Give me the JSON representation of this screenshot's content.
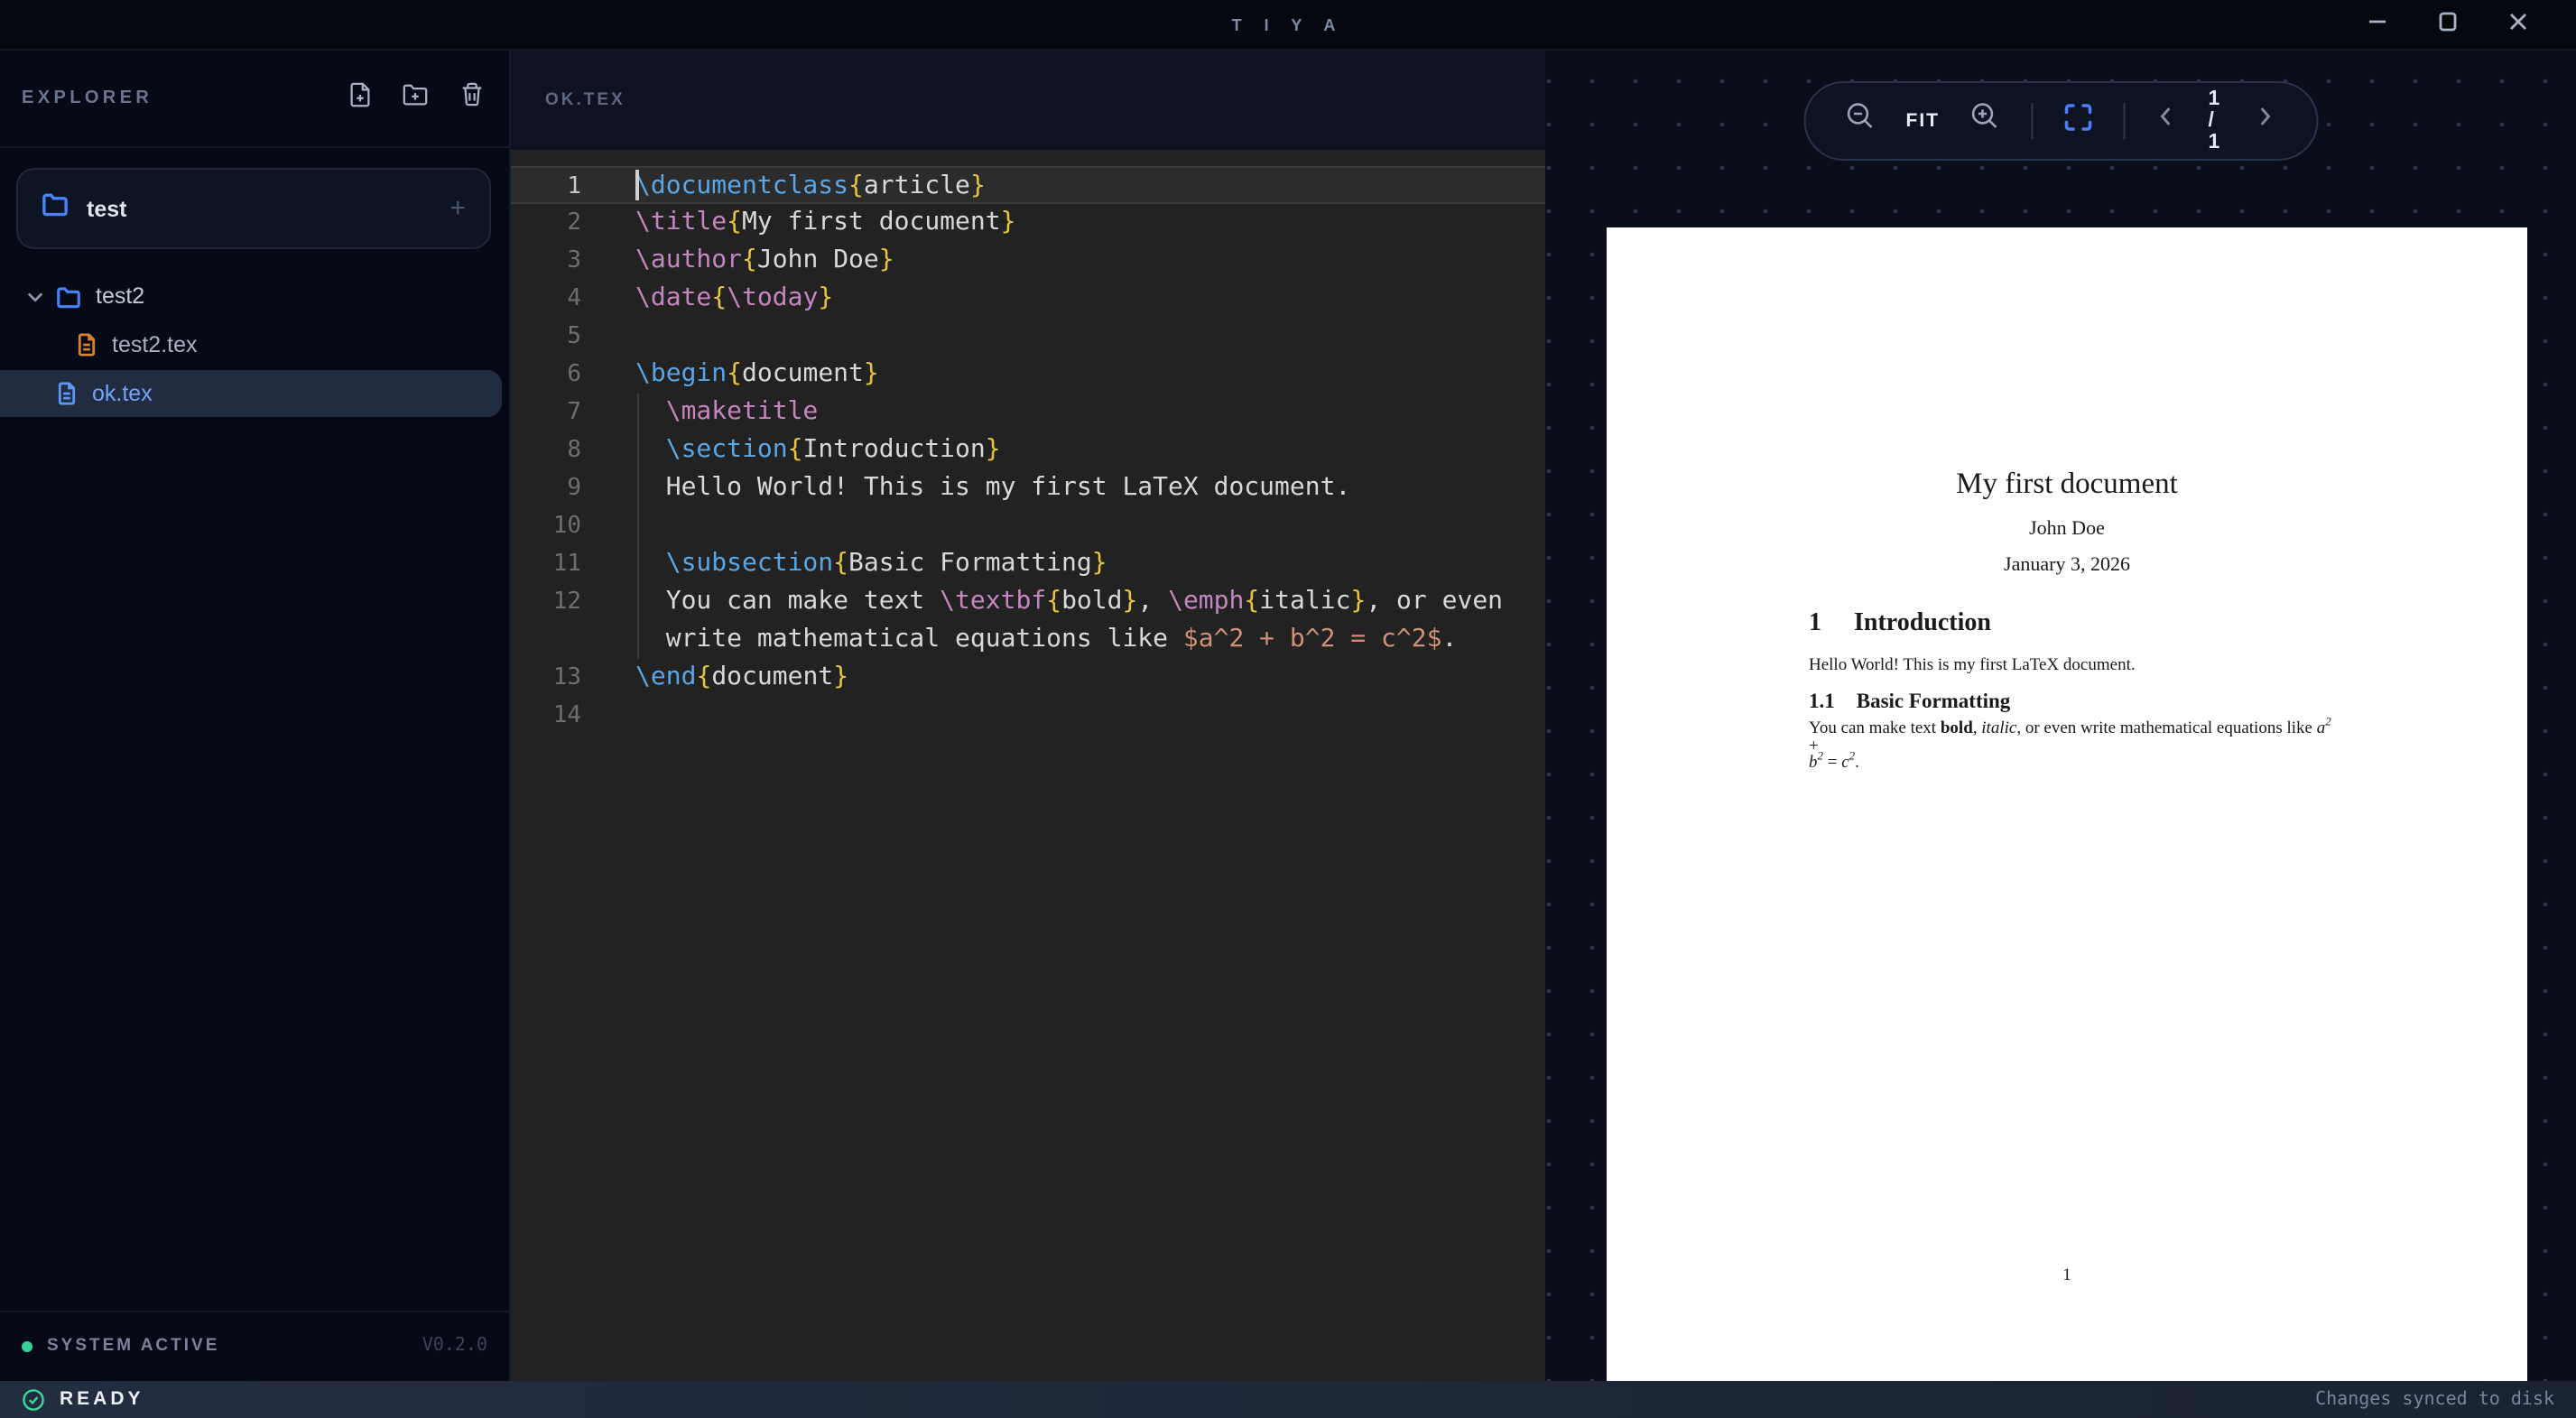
{
  "window": {
    "title": "T I Y A"
  },
  "sidebar": {
    "header": {
      "title": "EXPLORER"
    },
    "workspace": {
      "name": "test",
      "plus": "+"
    },
    "tree": [
      {
        "name": "test2",
        "kind": "folder",
        "expanded": true,
        "icon_color": "#4a82f7",
        "label_color": "#c3cad6",
        "indent": 0,
        "selected": false
      },
      {
        "name": "test2.tex",
        "kind": "file",
        "icon_color": "#d9822f",
        "label_color": "#aab2c2",
        "indent": 1,
        "selected": false
      },
      {
        "name": "ok.tex",
        "kind": "file",
        "icon_color": "#5e97f5",
        "label_color": "#76a3f7",
        "indent": 0,
        "selected": true
      }
    ],
    "footer": {
      "status": "SYSTEM ACTIVE",
      "version": "V0.2.0",
      "status_color": "#35d399"
    }
  },
  "editor": {
    "tab": "OK.TEX",
    "colors": {
      "cmd": "#58a6e6",
      "def": "#c586c0",
      "brace": "#e7c43d",
      "math": "#ce9178",
      "plain": "#d8d8d8"
    },
    "rows": [
      {
        "num": "1",
        "current": true,
        "tokens": [
          [
            "\\documentclass",
            "cmd"
          ],
          [
            "{",
            "brace"
          ],
          [
            "article",
            "plain"
          ],
          [
            "}",
            "brace"
          ]
        ]
      },
      {
        "num": "2",
        "tokens": [
          [
            "\\title",
            "def"
          ],
          [
            "{",
            "brace"
          ],
          [
            "My first document",
            "plain"
          ],
          [
            "}",
            "brace"
          ]
        ]
      },
      {
        "num": "3",
        "tokens": [
          [
            "\\author",
            "def"
          ],
          [
            "{",
            "brace"
          ],
          [
            "John Doe",
            "plain"
          ],
          [
            "}",
            "brace"
          ]
        ]
      },
      {
        "num": "4",
        "tokens": [
          [
            "\\date",
            "def"
          ],
          [
            "{",
            "brace"
          ],
          [
            "\\today",
            "def"
          ],
          [
            "}",
            "brace"
          ]
        ]
      },
      {
        "num": "5",
        "tokens": []
      },
      {
        "num": "6",
        "tokens": [
          [
            "\\begin",
            "cmd"
          ],
          [
            "{",
            "brace"
          ],
          [
            "document",
            "plain"
          ],
          [
            "}",
            "brace"
          ]
        ]
      },
      {
        "num": "7",
        "tokens": [
          [
            "  ",
            "plain"
          ],
          [
            "\\maketitle",
            "def"
          ]
        ]
      },
      {
        "num": "8",
        "tokens": [
          [
            "  ",
            "plain"
          ],
          [
            "\\section",
            "cmd"
          ],
          [
            "{",
            "brace"
          ],
          [
            "Introduction",
            "plain"
          ],
          [
            "}",
            "brace"
          ]
        ]
      },
      {
        "num": "9",
        "tokens": [
          [
            "  Hello World! This is my first LaTeX document.",
            "plain"
          ]
        ]
      },
      {
        "num": "10",
        "tokens": []
      },
      {
        "num": "11",
        "tokens": [
          [
            "  ",
            "plain"
          ],
          [
            "\\subsection",
            "cmd"
          ],
          [
            "{",
            "brace"
          ],
          [
            "Basic Formatting",
            "plain"
          ],
          [
            "}",
            "brace"
          ]
        ]
      },
      {
        "num": "12",
        "tokens": [
          [
            "  You can make text ",
            "plain"
          ],
          [
            "\\textbf",
            "def"
          ],
          [
            "{",
            "brace"
          ],
          [
            "bold",
            "plain"
          ],
          [
            "}",
            "brace"
          ],
          [
            ", ",
            "plain"
          ],
          [
            "\\emph",
            "def"
          ],
          [
            "{",
            "brace"
          ],
          [
            "italic",
            "plain"
          ],
          [
            "}",
            "brace"
          ],
          [
            ", or even",
            "plain"
          ]
        ]
      },
      {
        "num": "",
        "tokens": [
          [
            "  write mathematical equations like ",
            "plain"
          ],
          [
            "$a^2 + b^2 = c^2$",
            "math"
          ],
          [
            ".",
            "plain"
          ]
        ]
      },
      {
        "num": "13",
        "tokens": [
          [
            "\\end",
            "cmd"
          ],
          [
            "{",
            "brace"
          ],
          [
            "document",
            "plain"
          ],
          [
            "}",
            "brace"
          ]
        ]
      },
      {
        "num": "14",
        "tokens": []
      }
    ]
  },
  "preview": {
    "toolbar": {
      "fit": "FIT",
      "page_indicator": "1 / 1",
      "fullscreen_color": "#4d7ef7"
    },
    "page": {
      "title": "My first document",
      "author": "John Doe",
      "date": "January 3, 2026",
      "h1_num": "1",
      "h1_text": "Introduction",
      "p1": "Hello World! This is my first LaTeX document.",
      "h2_num": "1.1",
      "h2_text": "Basic Formatting",
      "p2_line1": [
        [
          "You can make text ",
          "r"
        ],
        [
          "bold",
          "b"
        ],
        [
          ", ",
          "r"
        ],
        [
          "italic",
          "i"
        ],
        [
          ", or even write mathematical equations like ",
          "r"
        ],
        [
          "a",
          "m"
        ],
        [
          "2",
          "s"
        ],
        [
          " +",
          "r"
        ]
      ],
      "p2_line2": [
        [
          "b",
          "m"
        ],
        [
          "2",
          "s"
        ],
        [
          " = ",
          "r"
        ],
        [
          "c",
          "m"
        ],
        [
          "2",
          "s"
        ],
        [
          ".",
          "r"
        ]
      ],
      "page_number": "1"
    }
  },
  "statusbar": {
    "left": "READY",
    "right": "Changes synced to disk",
    "ready_color": "#37d89a"
  }
}
